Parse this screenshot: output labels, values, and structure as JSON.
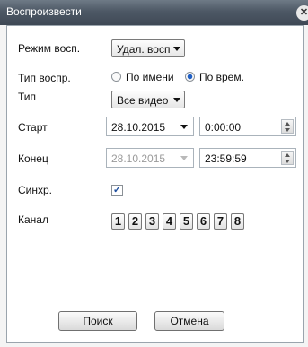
{
  "window": {
    "title": "Воспроизвести"
  },
  "mode": {
    "label": "Режим восп.",
    "value": "Удал. восп"
  },
  "playback_type": {
    "label": "Тип воспр.",
    "options": [
      "По имени",
      "По врем."
    ],
    "selected": "По врем."
  },
  "type": {
    "label": "Тип",
    "value": "Все видео"
  },
  "start": {
    "label": "Старт",
    "date": "28.10.2015",
    "time": "0:00:00"
  },
  "end": {
    "label": "Конец",
    "date": "28.10.2015",
    "time": "23:59:59"
  },
  "sync": {
    "label": "Синхр.",
    "checked": true
  },
  "channel": {
    "label": "Канал",
    "items": [
      "1",
      "2",
      "3",
      "4",
      "5",
      "6",
      "7",
      "8"
    ]
  },
  "buttons": {
    "search": "Поиск",
    "cancel": "Отмена"
  },
  "icons": {
    "close": "close-icon",
    "dropdown": "chevron-down-icon",
    "spin": "spin-icon"
  },
  "colors": {
    "titlebar": "#4d5865",
    "radio_selected": "#1f5fc4"
  }
}
